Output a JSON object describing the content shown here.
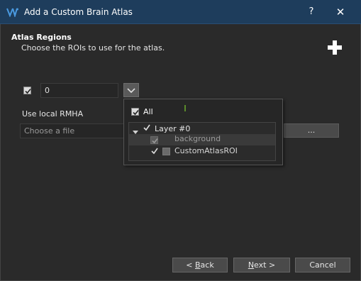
{
  "window": {
    "title": "Add a Custom Brain Atlas",
    "help_label": "?",
    "close_label": "✕"
  },
  "section": {
    "title": "Atlas Regions",
    "subtitle": "Choose the ROIs to use for the atlas."
  },
  "roi_row": {
    "checked": true,
    "value": "0"
  },
  "local_rmha": {
    "label": "Use local RMHA",
    "placeholder": "Choose a file",
    "browse_label": "..."
  },
  "dropdown": {
    "all_label": "All",
    "layer_label": "Layer #0",
    "items": [
      {
        "label": "background",
        "checked": true,
        "disabled": true
      },
      {
        "label": "CustomAtlasROI",
        "checked": true,
        "disabled": false
      }
    ]
  },
  "buttons": {
    "back_mnemonic": "B",
    "back_rest": "ack",
    "back_prefix": "< ",
    "next_mnemonic": "N",
    "next_rest": "ext >",
    "cancel": "Cancel"
  },
  "colors": {
    "titlebar": "#1e3d5c",
    "background": "#2a2a2a",
    "button": "#4a4a4a",
    "accent_icon": "#3b7fc4"
  },
  "icons": [
    "app-logo-icon",
    "plus-icon",
    "chevron-down-icon",
    "checkmark-icon",
    "caret-down-icon"
  ]
}
